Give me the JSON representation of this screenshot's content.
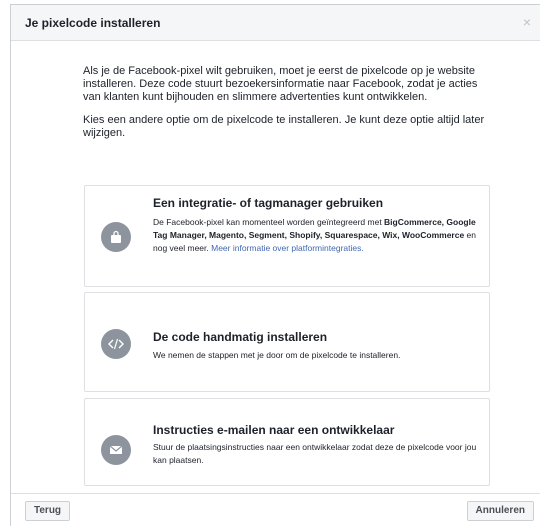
{
  "dialog": {
    "title": "Je pixelcode installeren",
    "close_glyph": "×"
  },
  "intro": {
    "paragraph1": "Als je de Facebook-pixel wilt gebruiken, moet je eerst de pixelcode op je website installeren. Deze code stuurt bezoekersinformatie naar Facebook, zodat je acties van klanten kunt bijhouden en slimmere advertenties kunt ontwikkelen.",
    "paragraph2": "Kies een andere optie om de pixelcode te installeren. Je kunt deze optie altijd later wijzigen."
  },
  "options": [
    {
      "title": "Een integratie- of tagmanager gebruiken",
      "description_prefix": "De Facebook-pixel kan momenteel worden geïntegreerd met ",
      "description_bold": "BigCommerce, Google Tag Manager, Magento, Segment, Shopify, Squarespace, Wix, WooCommerce",
      "description_suffix": " en nog veel meer. ",
      "link": "Meer informatie over platformintegraties.",
      "icon": "shopping-bag-icon"
    },
    {
      "title": "De code handmatig installeren",
      "description": "We nemen de stappen met je door om de pixelcode te installeren.",
      "icon": "code-icon"
    },
    {
      "title": "Instructies e-mailen naar een ontwikkelaar",
      "description": "Stuur de plaatsingsinstructies naar een ontwikkelaar zodat deze de pixelcode voor jou kan plaatsen.",
      "icon": "envelope-icon"
    }
  ],
  "footer": {
    "back_label": "Terug",
    "cancel_label": "Annuleren"
  },
  "colors": {
    "icon_circle": "#8d949e",
    "link": "#4267b2"
  }
}
